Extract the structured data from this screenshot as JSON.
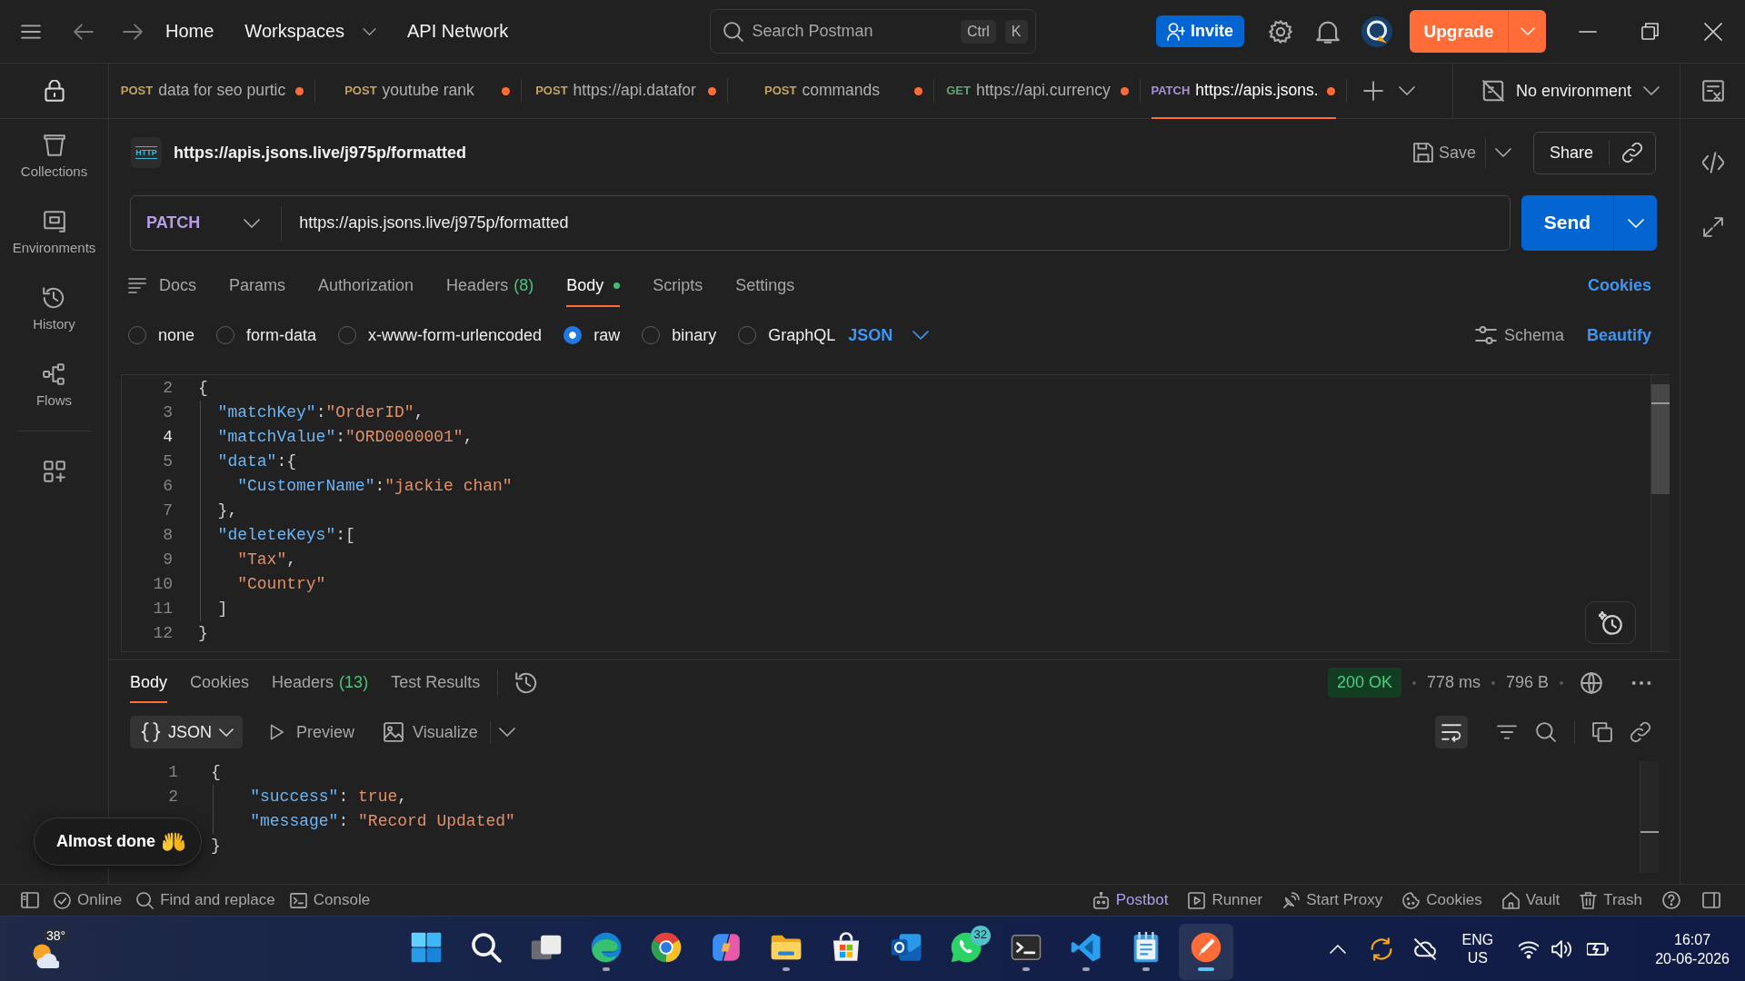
{
  "top_bar": {
    "nav": [
      {
        "label": "Home",
        "dropdown": false
      },
      {
        "label": "Workspaces",
        "dropdown": true
      },
      {
        "label": "API Network",
        "dropdown": false
      }
    ],
    "search": {
      "placeholder": "Search Postman",
      "keys": [
        "Ctrl",
        "K"
      ]
    },
    "invite": "Invite",
    "upgrade": "Upgrade"
  },
  "sidebar": {
    "items": [
      {
        "label": "Collections"
      },
      {
        "label": "Environments"
      },
      {
        "label": "History"
      },
      {
        "label": "Flows"
      }
    ]
  },
  "tabs": [
    {
      "method": "POST",
      "color": "#bfa35e",
      "name": "data for seo purtic",
      "unsaved": true,
      "selected": false
    },
    {
      "method": "POST",
      "color": "#bfa35e",
      "name": "youtube rank",
      "unsaved": true,
      "selected": false
    },
    {
      "method": "POST",
      "color": "#bfa35e",
      "name": "https://api.datafor",
      "unsaved": true,
      "selected": false
    },
    {
      "method": "POST",
      "color": "#bfa35e",
      "name": "commands",
      "unsaved": true,
      "selected": false
    },
    {
      "method": "GET",
      "color": "#5fa672",
      "name": "https://api.currency",
      "unsaved": true,
      "selected": false
    },
    {
      "method": "PATCH",
      "color": "#a990d6",
      "name": "https://apis.jsons.",
      "unsaved": true,
      "selected": true
    }
  ],
  "environment": {
    "label": "No environment"
  },
  "request": {
    "badge": "HTTP",
    "title": "https://apis.jsons.live/j975p/formatted",
    "save": "Save",
    "share": "Share",
    "method": "PATCH",
    "url": "https://apis.jsons.live/j975p/formatted",
    "send": "Send",
    "tabs": [
      {
        "label": "Docs",
        "selected": false
      },
      {
        "label": "Params",
        "selected": false
      },
      {
        "label": "Authorization",
        "selected": false
      },
      {
        "label": "Headers",
        "count": "(8)",
        "selected": false
      },
      {
        "label": "Body",
        "modified": true,
        "selected": true
      },
      {
        "label": "Scripts",
        "selected": false
      },
      {
        "label": "Settings",
        "selected": false
      }
    ],
    "cookies": "Cookies",
    "body_types": [
      {
        "label": "none",
        "selected": false
      },
      {
        "label": "form-data",
        "selected": false
      },
      {
        "label": "x-www-form-urlencoded",
        "selected": false
      },
      {
        "label": "raw",
        "selected": true
      },
      {
        "label": "binary",
        "selected": false
      },
      {
        "label": "GraphQL",
        "selected": false
      }
    ],
    "format": "JSON",
    "schema": "Schema",
    "beautify": "Beautify",
    "code": [
      {
        "number": "2",
        "current": false,
        "tokens": [
          {
            "kind": "punct",
            "text": "{"
          }
        ],
        "children": [
          {
            "number": "3",
            "current": false,
            "tokens": [
              {
                "kind": "key",
                "text": "\"matchKey\""
              },
              {
                "kind": "punct",
                "text": ":"
              },
              {
                "kind": "string",
                "text": "\"OrderID\""
              },
              {
                "kind": "punct",
                "text": ","
              }
            ]
          },
          {
            "number": "4",
            "current": true,
            "tokens": [
              {
                "kind": "key",
                "text": "\"matchValue\""
              },
              {
                "kind": "punct",
                "text": ":"
              },
              {
                "kind": "string",
                "text": "\"ORD0000001\""
              },
              {
                "kind": "punct",
                "text": ","
              }
            ]
          },
          {
            "number": "5",
            "current": false,
            "tokens": [
              {
                "kind": "key",
                "text": "\"data\""
              },
              {
                "kind": "punct",
                "text": ":{"
              }
            ],
            "children": [
              {
                "number": "6",
                "current": false,
                "tokens": [
                  {
                    "kind": "key",
                    "text": "\"CustomerName\""
                  },
                  {
                    "kind": "punct",
                    "text": ":"
                  },
                  {
                    "kind": "string",
                    "text": "\"jackie chan\""
                  }
                ]
              }
            ]
          },
          {
            "number": "7",
            "current": false,
            "tokens": [
              {
                "kind": "punct",
                "text": "},"
              }
            ]
          },
          {
            "number": "8",
            "current": false,
            "tokens": [
              {
                "kind": "key",
                "text": "\"deleteKeys\""
              },
              {
                "kind": "punct",
                "text": ":["
              }
            ],
            "children": [
              {
                "number": "9",
                "current": false,
                "tokens": [
                  {
                    "kind": "string",
                    "text": "\"Tax\""
                  },
                  {
                    "kind": "punct",
                    "text": ","
                  }
                ]
              },
              {
                "number": "10",
                "current": false,
                "tokens": [
                  {
                    "kind": "string",
                    "text": "\"Country\""
                  }
                ]
              }
            ]
          },
          {
            "number": "11",
            "current": false,
            "tokens": [
              {
                "kind": "punct",
                "text": "]"
              }
            ]
          }
        ]
      },
      {
        "number": "12",
        "current": false,
        "tokens": [
          {
            "kind": "punct",
            "text": "}"
          }
        ]
      }
    ]
  },
  "response": {
    "tabs": [
      {
        "label": "Body",
        "selected": true
      },
      {
        "label": "Cookies",
        "selected": false
      },
      {
        "label": "Headers",
        "count": "(13)",
        "selected": false
      },
      {
        "label": "Test Results",
        "selected": false
      }
    ],
    "status": "200 OK",
    "time": "778 ms",
    "size": "796 B",
    "format": "JSON",
    "preview": "Preview",
    "visualize": "Visualize",
    "code": [
      {
        "number": "1",
        "tokens": [
          {
            "kind": "punct",
            "text": "{"
          }
        ],
        "children": [
          {
            "number": "2",
            "tokens": [
              {
                "kind": "key",
                "text": "\"success\""
              },
              {
                "kind": "punct",
                "text": ": "
              },
              {
                "kind": "literal",
                "text": "true"
              },
              {
                "kind": "punct",
                "text": ","
              }
            ]
          },
          {
            "tokens": [
              {
                "kind": "key",
                "text": "\"message\""
              },
              {
                "kind": "punct",
                "text": ": "
              },
              {
                "kind": "string",
                "text": "\"Record Updated\""
              }
            ]
          }
        ]
      },
      {
        "tokens": [
          {
            "kind": "punct",
            "text": "}"
          }
        ]
      }
    ]
  },
  "toast": {
    "text": "Almost done"
  },
  "status_bar": {
    "left": [
      {
        "label": "Online"
      },
      {
        "label": "Find and replace"
      },
      {
        "label": "Console"
      }
    ],
    "right": [
      {
        "label": "Postbot",
        "color": "#b09cf0"
      },
      {
        "label": "Runner",
        "color": "#a6a6a6"
      },
      {
        "label": "Start Proxy",
        "color": "#a6a6a6"
      },
      {
        "label": "Cookies",
        "color": "#a6a6a6"
      },
      {
        "label": "Vault",
        "color": "#a6a6a6"
      },
      {
        "label": "Trash",
        "color": "#a6a6a6"
      }
    ]
  },
  "taskbar": {
    "weather": "38°",
    "apps": [
      {
        "running": false,
        "selected": false
      },
      {
        "running": false,
        "selected": false
      },
      {
        "running": false,
        "selected": false
      },
      {
        "running": true,
        "selected": false
      },
      {
        "running": false,
        "selected": false
      },
      {
        "running": false,
        "selected": false
      },
      {
        "running": true,
        "selected": false
      },
      {
        "running": false,
        "selected": false
      },
      {
        "running": false,
        "selected": false
      },
      {
        "running": false,
        "selected": false,
        "badge": "32"
      },
      {
        "running": true,
        "selected": false
      },
      {
        "running": true,
        "selected": false
      },
      {
        "running": true,
        "selected": false
      },
      {
        "running": true,
        "selected": true
      }
    ],
    "language": [
      "ENG",
      "US"
    ],
    "time": "16:07",
    "date": "20-06-2026"
  }
}
